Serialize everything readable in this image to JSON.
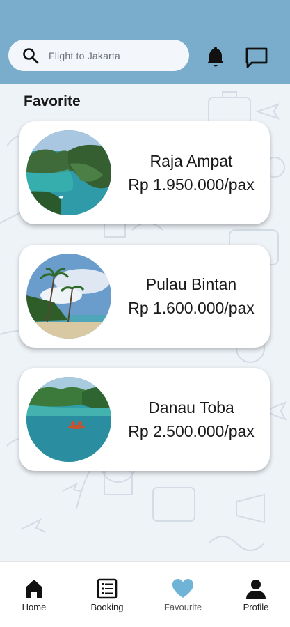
{
  "search": {
    "placeholder": "Flight to Jakarta"
  },
  "icons": {
    "search": "search-icon",
    "notifications": "bell-icon",
    "messages": "chat-icon"
  },
  "page": {
    "title": "Favorite"
  },
  "favorites": [
    {
      "name": "Raja Ampat",
      "price": "Rp 1.950.000/pax"
    },
    {
      "name": "Pulau Bintan",
      "price": "Rp 1.600.000/pax"
    },
    {
      "name": "Danau Toba",
      "price": "Rp 2.500.000/pax"
    }
  ],
  "nav": [
    {
      "label": "Home",
      "icon": "home-icon"
    },
    {
      "label": "Booking",
      "icon": "booking-icon"
    },
    {
      "label": "Favourite",
      "icon": "heart-icon",
      "active": true
    },
    {
      "label": "Profile",
      "icon": "profile-icon"
    }
  ],
  "colors": {
    "header": "#7aaccc",
    "background": "#eef3f8",
    "active_nav": "#6fb3d6"
  }
}
